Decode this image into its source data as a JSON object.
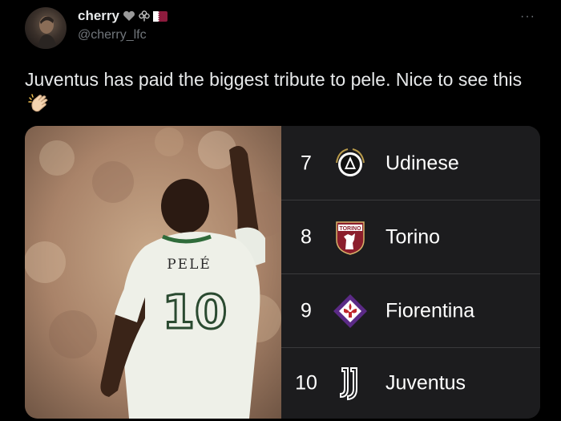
{
  "tweet": {
    "display_name": "cherry",
    "handle": "@cherry_lfc",
    "more_label": "···",
    "text": "Juventus has paid the biggest tribute to pele. Nice to see this",
    "emoji_icon": "clapping-hands-icon"
  },
  "photo": {
    "shirt_name": "PELÉ",
    "shirt_number": "10"
  },
  "standings": [
    {
      "position": "7",
      "club": "Udinese",
      "crest": "udinese-crest-icon"
    },
    {
      "position": "8",
      "club": "Torino",
      "crest": "torino-crest-icon",
      "crest_text": "TORINO"
    },
    {
      "position": "9",
      "club": "Fiorentina",
      "crest": "fiorentina-crest-icon"
    },
    {
      "position": "10",
      "club": "Juventus",
      "crest": "juventus-crest-icon"
    }
  ],
  "colors": {
    "background": "#000000",
    "text": "#e7e9ea",
    "muted": "#71767b",
    "table_bg": "#1c1c1e",
    "torino": "#8b1e2c",
    "fiorentina": "#5b2a86"
  }
}
